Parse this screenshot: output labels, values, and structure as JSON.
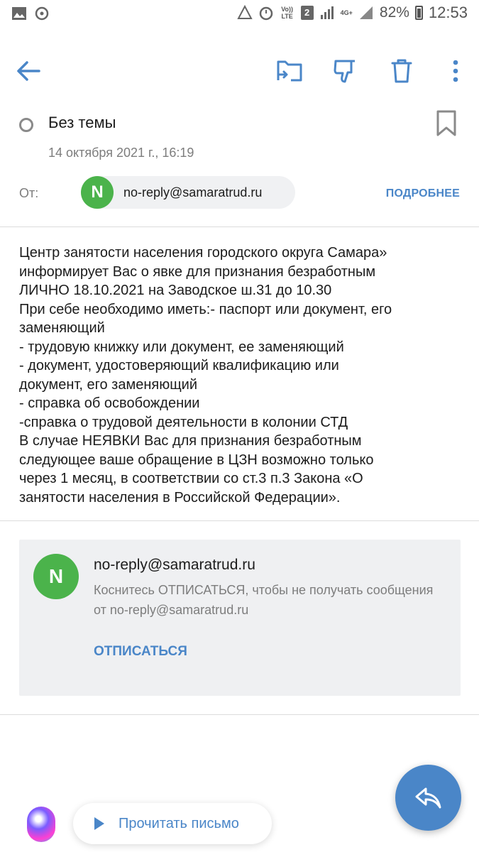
{
  "status_bar": {
    "notification_count": "2",
    "volte_label": "Vo)) LTE",
    "network_label": "4G+",
    "battery": "82%",
    "time": "12:53"
  },
  "toolbar": {
    "back_icon": "arrow-left-icon",
    "move_icon": "folder-move-icon",
    "spam_icon": "thumbs-down-icon",
    "delete_icon": "trash-icon",
    "more_icon": "more-vertical-icon"
  },
  "message": {
    "subject": "Без темы",
    "date": "14 октября 2021 г., 16:19",
    "from_label": "От:",
    "sender_initial": "N",
    "sender_email": "no-reply@samaratrud.ru",
    "details_label": "ПОДРОБНЕЕ",
    "body_lines": [
      "Центр занятости населения городского округа Самара»",
      "информирует Вас о явке для признания безработным",
      "ЛИЧНО 18.10.2021 на Заводское ш.31 до 10.30",
      "При себе необходимо иметь:- паспорт или документ, его",
      "заменяющий",
      "- трудовую книжку или документ, ее заменяющий",
      "- документ, удостоверяющий квалификацию или",
      "документ, его заменяющий",
      "- справка об освобождении",
      "-справка о трудовой деятельности в колонии СТД",
      "В случае НЕЯВКИ Вас для признания безработным",
      "следующее ваше обращение в ЦЗН возможно только",
      "через 1 месяц, в соответствии со ст.3 п.3 Закона «О",
      "занятости населения в Российской Федерации»."
    ]
  },
  "unsubscribe": {
    "initial": "N",
    "email": "no-reply@samaratrud.ru",
    "note": "Коснитесь ОТПИСАТЬСЯ, чтобы не получать сообщения от no-reply@samaratrud.ru",
    "action": "ОТПИСАТЬСЯ"
  },
  "bottom": {
    "read_aloud": "Прочитать письмо",
    "reply_icon": "reply-icon"
  },
  "colors": {
    "accent": "#4a86c8",
    "avatar_green": "#4bb34b",
    "card_bg": "#eff0f2"
  }
}
